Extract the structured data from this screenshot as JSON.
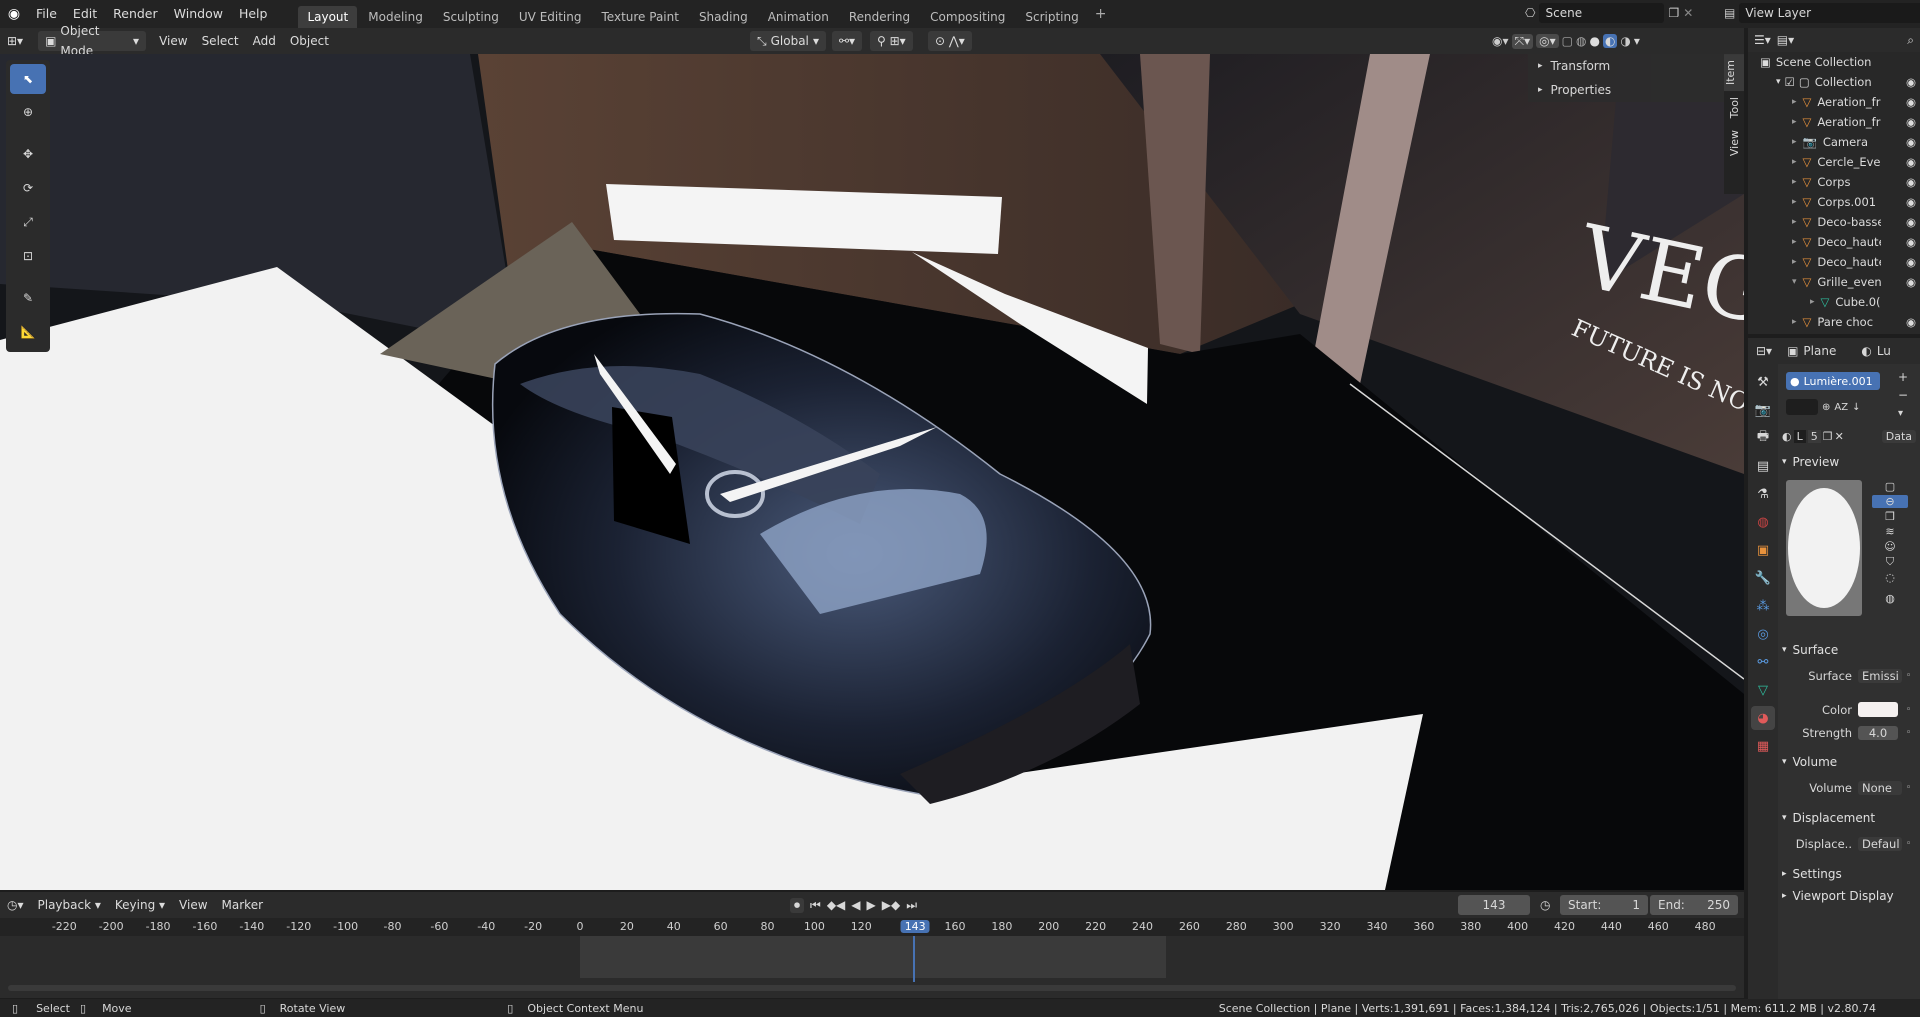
{
  "menus": [
    "File",
    "Edit",
    "Render",
    "Window",
    "Help"
  ],
  "workspace_tabs": [
    "Layout",
    "Modeling",
    "Sculpting",
    "UV Editing",
    "Texture Paint",
    "Shading",
    "Animation",
    "Rendering",
    "Compositing",
    "Scripting"
  ],
  "active_tab": "Layout",
  "scene": {
    "name": "Scene"
  },
  "view_layer": {
    "name": "View Layer"
  },
  "viewport_header": {
    "mode": "Object Mode",
    "menus": [
      "View",
      "Select",
      "Add",
      "Object"
    ],
    "orientation": "Global"
  },
  "n_panel": {
    "sections": [
      "Transform",
      "Properties"
    ],
    "tabs": [
      "Item",
      "Tool",
      "View"
    ]
  },
  "scene_text": {
    "brand": "VEG",
    "tagline": "FUTURE IS NOW"
  },
  "outliner": {
    "root": "Scene Collection",
    "collection": "Collection",
    "items": [
      "Aeration_fr",
      "Aeration_fr",
      "Camera",
      "Cercle_Ever",
      "Corps",
      "Corps.001",
      "Deco-basse",
      "Deco_haute",
      "Deco_haute",
      "Grille_even",
      "Cube.0(",
      "Pare choc"
    ]
  },
  "properties": {
    "object_name": "Plane",
    "object_name2": "Lu",
    "material_slot": "Lumière.001",
    "slot_letter": "L",
    "slot_count": "5",
    "data_label": "Data",
    "sections": {
      "preview": "Preview",
      "surface": "Surface",
      "volume": "Volume",
      "displacement": "Displacement",
      "settings": "Settings",
      "viewport_display": "Viewport Display"
    },
    "surface_label": "Surface",
    "surface_value": "Emissi",
    "color_label": "Color",
    "color_value": "#f5f1f0",
    "strength_label": "Strength",
    "strength_value": "4.0",
    "volume_label": "Volume",
    "volume_value": "None",
    "displacement_label": "Displace..",
    "displacement_value": "Defaul"
  },
  "timeline": {
    "menus": [
      "Playback",
      "Keying",
      "View",
      "Marker"
    ],
    "current_frame": "143",
    "start_label": "Start:",
    "start": "1",
    "end_label": "End:",
    "end": "250",
    "ticks": [
      "-220",
      "-200",
      "-180",
      "-160",
      "-140",
      "-120",
      "-100",
      "-80",
      "-60",
      "-40",
      "-20",
      "0",
      "20",
      "40",
      "60",
      "80",
      "100",
      "120",
      "143",
      "160",
      "180",
      "200",
      "220",
      "240",
      "260",
      "280",
      "300",
      "320",
      "340",
      "360",
      "380",
      "400",
      "420",
      "440",
      "460",
      "480"
    ]
  },
  "statusbar": {
    "select": "Select",
    "move": "Move",
    "rotate": "Rotate View",
    "context": "Object Context Menu",
    "stats": "Scene Collection | Plane | Verts:1,391,691 | Faces:1,384,124 | Tris:2,765,026 | Objects:1/51 | Mem: 611.2 MB | v2.80.74"
  },
  "colors": {
    "accent": "#4772b3",
    "object_orange": "#e8923c",
    "mesh_green": "#2fbf9f"
  }
}
